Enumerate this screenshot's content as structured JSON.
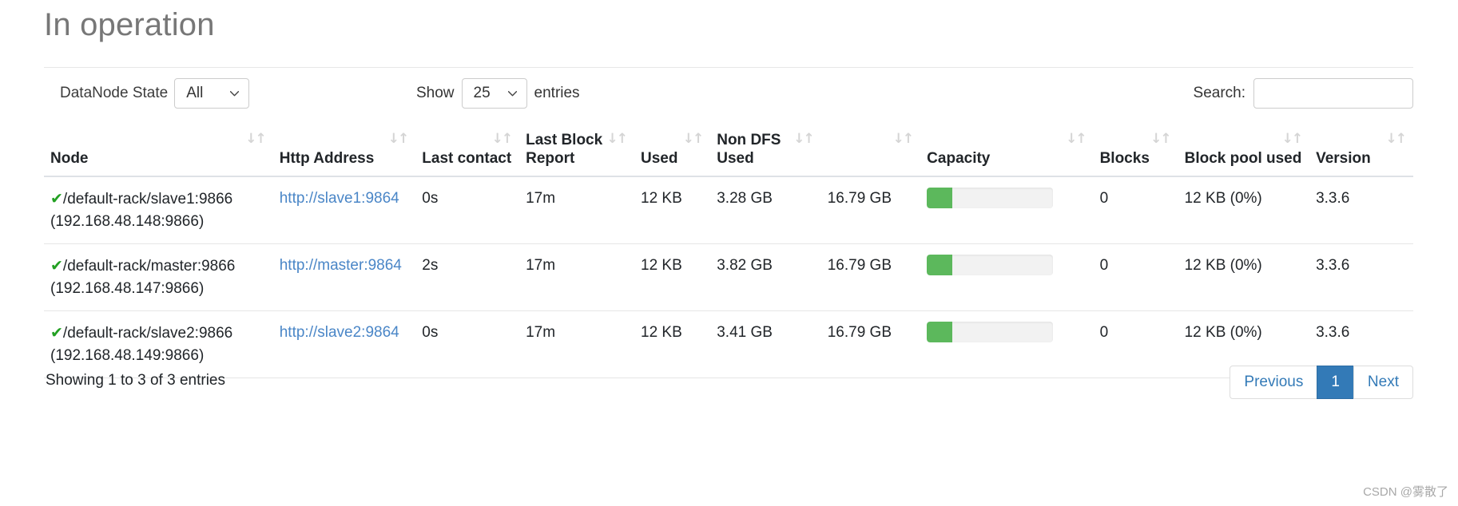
{
  "page": {
    "title": "In operation",
    "watermark": "CSDN @雾散了"
  },
  "controls": {
    "datanode_state_label": "DataNode State",
    "datanode_state_value": "All",
    "datanode_state_options": [
      "All"
    ],
    "show_label": "Show",
    "entries_value": "25",
    "entries_options": [
      "25"
    ],
    "entries_label": "entries",
    "search_label": "Search:",
    "search_value": "",
    "search_placeholder": ""
  },
  "table": {
    "headers": [
      {
        "label": "Node",
        "sort": "↓↑"
      },
      {
        "label": "Http Address",
        "sort": "↓↑"
      },
      {
        "label": "Last contact",
        "sort": "↓↑"
      },
      {
        "label": "Last Block Report",
        "sort": "↓↑"
      },
      {
        "label": "Used",
        "sort": "↓↑"
      },
      {
        "label": "Non DFS Used",
        "sort": "↓↑"
      },
      {
        "label": "",
        "sort": "↓↑"
      },
      {
        "label": "Capacity",
        "sort": "↓↑"
      },
      {
        "label": "Blocks",
        "sort": "↓↑"
      },
      {
        "label": "Block pool used",
        "sort": "↓↑"
      },
      {
        "label": "Version",
        "sort": "↓↑"
      }
    ],
    "rows": [
      {
        "status_icon": "✔",
        "node": "/default-rack/slave1:9866",
        "node_ip": "(192.168.48.148:9866)",
        "http_address": "http://slave1:9864",
        "last_contact": "0s",
        "last_block_report": "17m",
        "used": "12 KB",
        "non_dfs_used": "3.28 GB",
        "capacity_text": "16.79 GB",
        "capacity_percent": 20,
        "blocks": "0",
        "block_pool_used": "12 KB (0%)",
        "version": "3.3.6"
      },
      {
        "status_icon": "✔",
        "node": "/default-rack/master:9866",
        "node_ip": "(192.168.48.147:9866)",
        "http_address": "http://master:9864",
        "last_contact": "2s",
        "last_block_report": "17m",
        "used": "12 KB",
        "non_dfs_used": "3.82 GB",
        "capacity_text": "16.79 GB",
        "capacity_percent": 20,
        "blocks": "0",
        "block_pool_used": "12 KB (0%)",
        "version": "3.3.6"
      },
      {
        "status_icon": "✔",
        "node": "/default-rack/slave2:9866",
        "node_ip": "(192.168.48.149:9866)",
        "http_address": "http://slave2:9864",
        "last_contact": "0s",
        "last_block_report": "17m",
        "used": "12 KB",
        "non_dfs_used": "3.41 GB",
        "capacity_text": "16.79 GB",
        "capacity_percent": 20,
        "blocks": "0",
        "block_pool_used": "12 KB (0%)",
        "version": "3.3.6"
      }
    ]
  },
  "footer": {
    "info": "Showing 1 to 3 of 3 entries",
    "previous_label": "Previous",
    "page_label": "1",
    "next_label": "Next"
  },
  "colors": {
    "accent": "#337ab7",
    "progress": "#5cb85c",
    "check": "#22a022",
    "link": "#4a86c7",
    "title": "#777777"
  }
}
